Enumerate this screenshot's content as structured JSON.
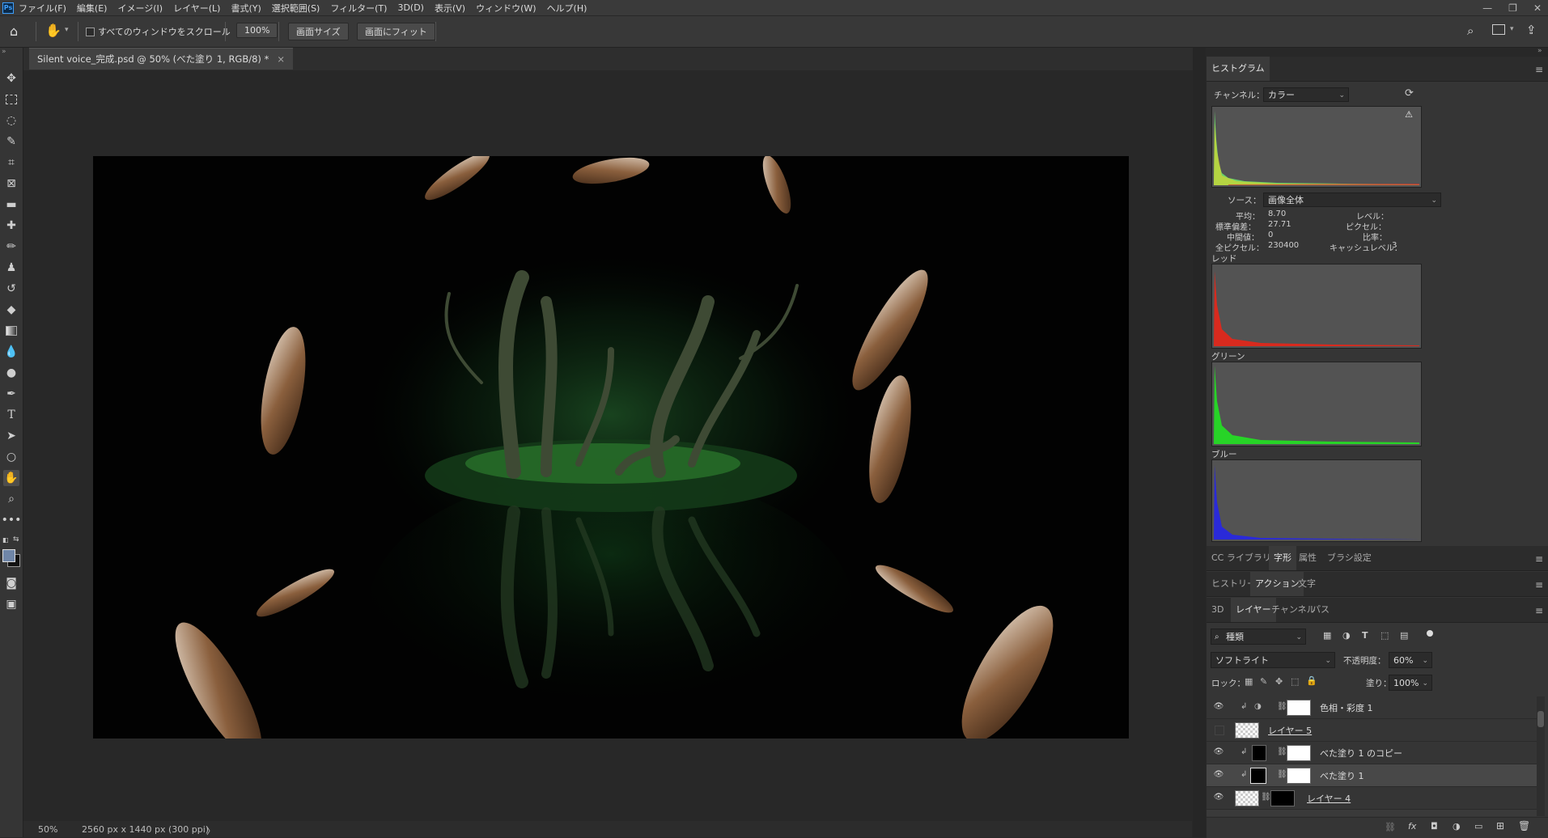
{
  "app": {
    "logo": "Ps"
  },
  "menu": [
    "ファイル(F)",
    "編集(E)",
    "イメージ(I)",
    "レイヤー(L)",
    "書式(Y)",
    "選択範囲(S)",
    "フィルター(T)",
    "3D(D)",
    "表示(V)",
    "ウィンドウ(W)",
    "ヘルプ(H)"
  ],
  "options": {
    "scroll_all_label": "すべてのウィンドウをスクロール",
    "zoom_value": "100%",
    "fit_screen_label": "画面サイズ",
    "fill_screen_label": "画面にフィット"
  },
  "document": {
    "tab_title": "Silent voice_完成.psd @ 50% (べた塗り 1, RGB/8) *",
    "close": "×"
  },
  "status": {
    "zoom": "50%",
    "info": "2560 px x 1440 px (300 ppi)",
    "arrow": "〉"
  },
  "histogram": {
    "tab": "ヒストグラム",
    "channel_label": "チャンネル：",
    "channel_value": "カラー",
    "source_label": "ソース：",
    "source_value": "画像全体",
    "stats": {
      "mean_label": "平均：",
      "mean": "8.70",
      "stddev_label": "標準偏差：",
      "stddev": "27.71",
      "median_label": "中間値：",
      "median": "0",
      "pixels_label": "全ピクセル：",
      "pixels": "230400",
      "level_label": "レベル：",
      "count_label": "ピクセル：",
      "percentile_label": "比率：",
      "cache_label": "キャッシュレベル：",
      "cache": "3"
    },
    "red_label": "レッド",
    "green_label": "グリーン",
    "blue_label": "ブルー"
  },
  "panel_group1": [
    "CC ライブラリ",
    "字形",
    "属性",
    "ブラシ設定"
  ],
  "panel_group2": [
    "ヒストリー",
    "アクション",
    "文字"
  ],
  "panel_group3": [
    "3D",
    "レイヤー",
    "チャンネル",
    "パス"
  ],
  "layers_panel": {
    "filter_kind": "種類",
    "blend_mode": "ソフトライト",
    "opacity_label": "不透明度：",
    "opacity_value": "60%",
    "lock_label": "ロック：",
    "fill_label": "塗り：",
    "fill_value": "100%",
    "layers": [
      {
        "name": "色相・彩度 1",
        "visible": true
      },
      {
        "name": "レイヤー 5",
        "visible": false
      },
      {
        "name": "べた塗り 1 のコピー",
        "visible": true
      },
      {
        "name": "べた塗り 1",
        "visible": true,
        "selected": true
      },
      {
        "name": "レイヤー 4",
        "visible": true
      }
    ],
    "footer_icons": [
      "link-icon",
      "fx-icon",
      "mask-icon",
      "adjustment-icon",
      "folder-icon",
      "new-layer-icon",
      "trash-icon"
    ]
  },
  "colors": {
    "accent": "#31a8ff",
    "panel": "#353535",
    "canvas_bg": "#282828"
  }
}
